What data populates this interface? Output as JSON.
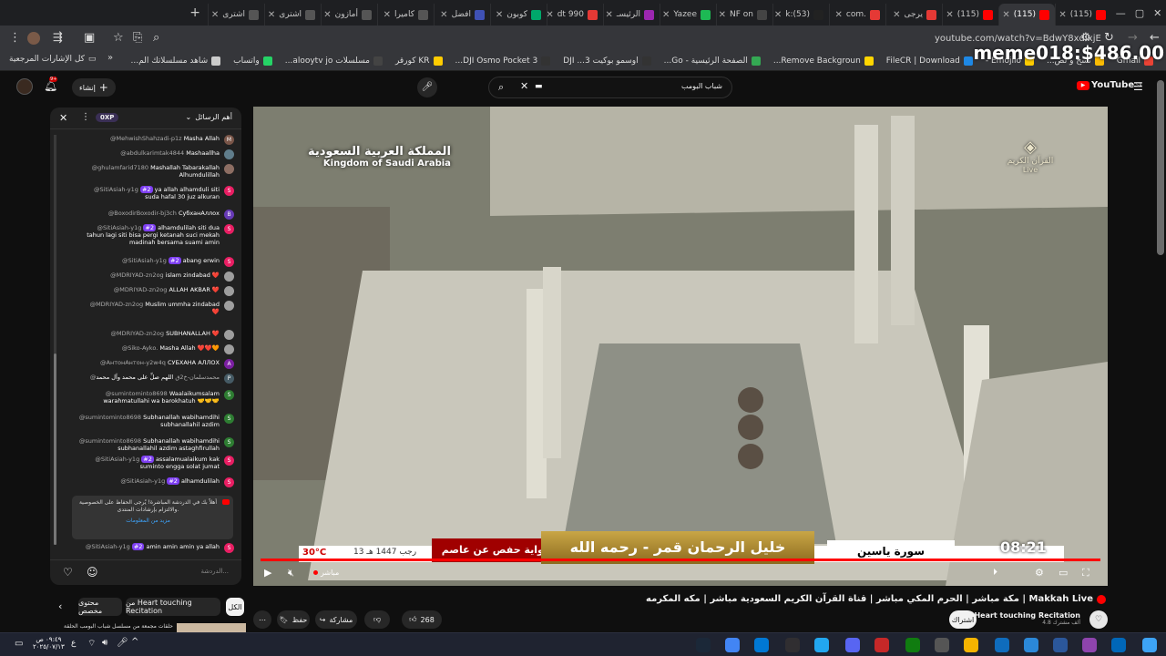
{
  "browser": {
    "tabs": [
      {
        "label": "(115)",
        "color": "#ff0000",
        "active": false
      },
      {
        "label": "(115)",
        "color": "#ff0000",
        "active": true
      },
      {
        "label": "(115)",
        "color": "#ff0000",
        "active": false
      },
      {
        "label": "يرجى",
        "color": "#e53935",
        "active": false
      },
      {
        "label": ".com",
        "color": "#e53935",
        "active": false
      },
      {
        "label": "(53):k",
        "color": "#222222",
        "active": false
      },
      {
        "label": "NF on",
        "color": "#444444",
        "active": false
      },
      {
        "label": "Yazee",
        "color": "#1db954",
        "active": false
      },
      {
        "label": "الرئيسـ",
        "color": "#9c27b0",
        "active": false
      },
      {
        "label": "dt 990",
        "color": "#e53935",
        "active": false
      },
      {
        "label": "كوبون",
        "color": "#00a86b",
        "active": false
      },
      {
        "label": "افضل",
        "color": "#3f51b5",
        "active": false
      },
      {
        "label": "كاميرا",
        "color": "#555555",
        "active": false
      },
      {
        "label": "أمازون",
        "color": "#555555",
        "active": false
      },
      {
        "label": "اشترى",
        "color": "#555555",
        "active": false
      },
      {
        "label": "اشترى",
        "color": "#555555",
        "active": false
      }
    ],
    "url": "youtube.com/watch?v=BdwY8xdIxjE",
    "bookmarks": [
      {
        "label": "Gmail",
        "color": "#ea4335"
      },
      {
        "label": "نسخ و لص...",
        "color": "#fbbc04"
      },
      {
        "label": "Emojilo -",
        "color": "#ffcc00"
      },
      {
        "label": "FileCR | Download",
        "color": "#1e88e5"
      },
      {
        "label": "Remove Backgroun...",
        "color": "#ffd600"
      },
      {
        "label": "الصفحة الرئيسية - Go...",
        "color": "#34a853"
      },
      {
        "label": "اوسمو بوكيت 3... DJI",
        "color": "#333333"
      },
      {
        "label": "DJI Osmo Pocket 3...",
        "color": "#333333"
      },
      {
        "label": "KR كورقر",
        "color": "#ffcc00"
      },
      {
        "label": "مسلسلات alooytv jo...",
        "color": "#444444"
      },
      {
        "label": "واتساب",
        "color": "#25d366"
      },
      {
        "label": "شاهد مسلسلاتك الم...",
        "color": "#cccccc"
      }
    ],
    "bookmarks_folder": "كل الإشارات المرجعية"
  },
  "overlay_text": "meme018:$486.00",
  "youtube": {
    "logo": "YouTube",
    "logo_region": "SA",
    "search_value": "شباب البومب",
    "create_label": "إنشاء",
    "notif_count": "9+"
  },
  "chat": {
    "header": "أهم الرسائل",
    "xp": "0XP",
    "messages": [
      {
        "text": "Masha Allah",
        "user": "@MehwishShahzadi-p1z",
        "av": "M",
        "color": "#795548"
      },
      {
        "text": "Mashaallha",
        "user": "@abdulkarimtak4844",
        "av": "",
        "color": "#607d8b"
      },
      {
        "text": "Mashallah Tabarakallah",
        "user": "@ghulamfarid7180",
        "extra": "Alhumdulillah",
        "av": "",
        "color": "#8d6e63"
      },
      {
        "text": "ya allah alhamduli siti",
        "user": "@SitiAsiah-y1g",
        "extra": "suda hafal 30 juz alkuran",
        "badge": "#2",
        "av": "S",
        "color": "#e91e63"
      },
      {
        "text": "СубханАллох",
        "user": "@BoxodirBoxodir-bj3ch",
        "av": "B",
        "color": "#673ab7"
      },
      {
        "text": "alhamdulilah siti dua",
        "user": "@SitiAsiah-y1g",
        "extra": "tahun lagi siti bisa pergi ketanah suci mekah madinah bersama suami amin",
        "badge": "#2",
        "av": "S",
        "color": "#e91e63"
      },
      {
        "text": "abang erwin",
        "user": "@SitiAsiah-y1g",
        "badge": "#2",
        "av": "S",
        "color": "#e91e63"
      },
      {
        "text": "islam zindabad ❤️",
        "user": "@MDRIYAD-zn2og",
        "av": "",
        "color": "#9e9e9e"
      },
      {
        "text": "ALLAH AKBAR ❤️",
        "user": "@MDRIYAD-zn2og",
        "av": "",
        "color": "#9e9e9e"
      },
      {
        "text": "Muslim ummha zindabad",
        "user": "@MDRIYAD-zn2og",
        "extra": "❤️",
        "av": "",
        "color": "#9e9e9e"
      },
      {
        "text": "SUBHANALLAH ❤️",
        "user": "@MDRIYAD-zn2og",
        "av": "",
        "color": "#9e9e9e"
      },
      {
        "text": "Masha Allah ❤️❤️🧡",
        "user": "@Siko-Ayko.",
        "av": "",
        "color": "#9e9e9e"
      },
      {
        "text": "СУБХАНА АЛЛОХ",
        "user": "@АнтонАнтон-y2w4q",
        "av": "A",
        "color": "#7b1fa2"
      },
      {
        "text": "اللهم صلِّ على محمد وآل محمد",
        "user": "@محمدسلمان-خ2ق",
        "av": "P",
        "color": "#455a64"
      },
      {
        "text": "Waalaikumsalam",
        "user": "@sumintominto8698",
        "extra": "warahmatullahi wa barokhatuh 🤝🤝🤝",
        "av": "S",
        "color": "#2e7d32"
      },
      {
        "text": "Subhanallah wabihamdihi",
        "user": "@sumintominto8698",
        "extra": "subhanallahil azdim",
        "av": "S",
        "color": "#2e7d32"
      },
      {
        "text": "Subhanallah wabihamdihi",
        "user": "@sumintominto8698",
        "extra": "subhanallahil azdim astaghfirullah",
        "av": "S",
        "color": "#2e7d32"
      },
      {
        "text": "assalamualaikum kak",
        "user": "@SitiAsiah-y1g",
        "extra": "suminto engga solat jumat",
        "badge": "#2",
        "av": "S",
        "color": "#e91e63"
      },
      {
        "text": "alhamdulilah",
        "user": "@SitiAsiah-y1g",
        "badge": "#2",
        "av": "S",
        "color": "#e91e63"
      }
    ],
    "pinned_text": "أهلاً بك في الدردشة المباشرة! يُرجى الحفاظ على الخصوصية والالتزام بإرشادات المنتدى.",
    "pinned_link": "مزيد من المعلومات",
    "last_message": {
      "text": "amin amin amin ya allah",
      "user": "@SitiAsiah-y1g",
      "badge": "#2",
      "av": "S",
      "color": "#e91e63"
    },
    "input_placeholder": "الدردشة..."
  },
  "player": {
    "logo_ar": "المملكة العربية السعودية",
    "logo_en": "Kingdom of Saudi Arabia",
    "channel_ar": "القرآن الكريم",
    "channel_en": "Live",
    "reciter": "خليل الرحمان قمر - رحمه الله",
    "riwaya": "رواية حفص عن عاصم",
    "surah": "سورة ياسين",
    "temp": "30°C",
    "date": "13 رجب 1447 هـ",
    "time": "08:21",
    "live_label": "مباشر"
  },
  "video": {
    "title": "مكة مباشر | الحرم المكي مباشر | قناة القرآن الكريم السعودية مباشر | مكه المكرمه | Makkah Live",
    "likes": "268",
    "share_label": "مشاركة",
    "save_label": "حفظ",
    "channel_name": "Heart touching Recitation",
    "subscribers": "4.8 ألف مشترك",
    "subscribe_label": "اشتراك",
    "filter_all": "الكل",
    "filter_from": "من Heart touching Recitation",
    "filter_related": "محتوى مخصص",
    "next_video_title": "حلقات مجمعة من مسلسل شباب البومب الحلقة"
  },
  "taskbar": {
    "time": "٠٩:٤٩ ص",
    "date": "٢٠٢٥/٠٧/١٣",
    "lang": "ع"
  }
}
